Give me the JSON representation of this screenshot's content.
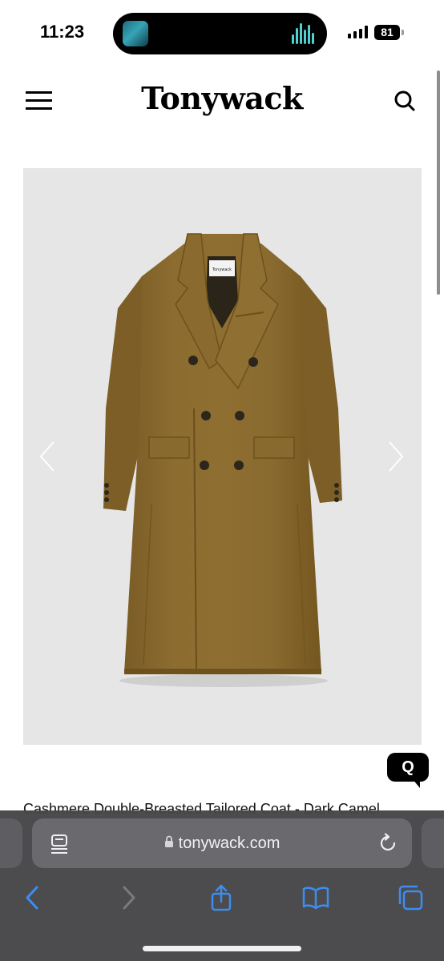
{
  "status_bar": {
    "time": "11:23",
    "battery": "81"
  },
  "header": {
    "brand": "Tonywack",
    "menu_icon": "hamburger-icon",
    "search_icon": "search-icon"
  },
  "product": {
    "image_alt": "Cashmere double-breasted tailored coat in dark camel",
    "title": "Cashmere Double-Breasted Tailored Coat - Dark Camel",
    "label_text": "Tonywack"
  },
  "chat": {
    "label": "Q"
  },
  "browser": {
    "url": "tonywack.com",
    "icons": {
      "reader": "reader-icon",
      "lock": "lock-icon",
      "reload": "reload-icon",
      "back": "back-chevron-icon",
      "forward": "forward-chevron-icon",
      "share": "share-icon",
      "bookmarks": "bookmarks-icon",
      "tabs": "tabs-icon"
    }
  },
  "colors": {
    "coat": "#8a6a2f",
    "gallery_bg": "#e6e6e6",
    "toolbar_bg": "#464648",
    "accent_blue": "#3b8ef0"
  }
}
